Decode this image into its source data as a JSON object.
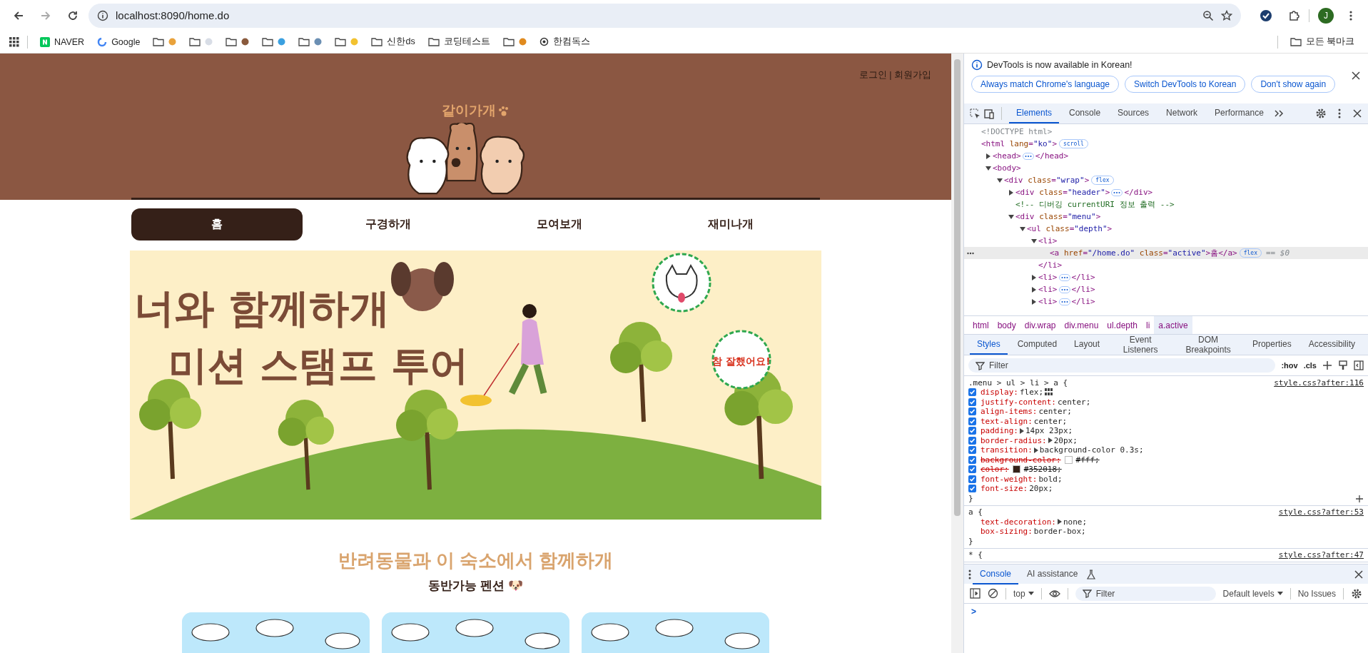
{
  "browser": {
    "url": "localhost:8090/home.do",
    "profile": "J",
    "bookmarks": [
      {
        "kind": "naver",
        "label": "NAVER"
      },
      {
        "kind": "google",
        "label": "Google"
      },
      {
        "kind": "folder",
        "color": "#e9a23b"
      },
      {
        "kind": "folder",
        "color": "#d8dde6"
      },
      {
        "kind": "folder",
        "color": "#8a5a3c"
      },
      {
        "kind": "folder",
        "color": "#3aa0e0"
      },
      {
        "kind": "folder",
        "color": "#6b8fb3"
      },
      {
        "kind": "folder",
        "color": "#f2c230"
      },
      {
        "kind": "folder",
        "label": "신한ds"
      },
      {
        "kind": "folder",
        "label": "코딩테스트"
      },
      {
        "kind": "folder",
        "color": "#e08a1e"
      },
      {
        "kind": "doc",
        "label": "한컴독스"
      }
    ],
    "all_bookmarks": "모든 북마크"
  },
  "page": {
    "auth": "로그인 | 회원가입",
    "logo": "같이가개",
    "menu": [
      {
        "label": "홈",
        "selected": true
      },
      {
        "label": "구경하개",
        "selected": false
      },
      {
        "label": "모여보개",
        "selected": false
      },
      {
        "label": "재미나개",
        "selected": false
      }
    ],
    "banner": {
      "title_line_1": "너와 함께하개",
      "title_line_2": "미션 스탬프 투어",
      "stamp": "참 잘했어요!"
    },
    "section_title": "반려동물과 이 숙소에서 함께하개",
    "section_subtitle": "동반가능 펜션 🐶"
  },
  "devtools": {
    "notice": {
      "message": "DevTools is now available in Korean!",
      "buttons": [
        "Always match Chrome's language",
        "Switch DevTools to Korean",
        "Don't show again"
      ]
    },
    "tabs": [
      {
        "label": "Elements",
        "selected": true
      },
      {
        "label": "Console",
        "selected": false
      },
      {
        "label": "Sources",
        "selected": false
      },
      {
        "label": "Network",
        "selected": false
      },
      {
        "label": "Performance",
        "selected": false
      }
    ],
    "dom": [
      {
        "kind": "doctype",
        "text": "<!DOCTYPE html>"
      },
      {
        "kind": "element",
        "text": "<html lang=\"ko\">",
        "badge": "scroll",
        "children": [
          {
            "kind": "element",
            "text": "<head>",
            "close": "</head>",
            "expanded": false
          },
          {
            "kind": "element",
            "text": "<body>",
            "expanded": true,
            "children": [
              {
                "kind": "element",
                "text": "<div class=\"wrap\">",
                "badge": "flex",
                "expanded": true,
                "children": [
                  {
                    "kind": "element",
                    "text": "<div class=\"header\">",
                    "close": "</div>",
                    "expanded": false
                  },
                  {
                    "kind": "comment",
                    "text": "<!-- 디버깅 currentURI 정보 출력 -->"
                  },
                  {
                    "kind": "element",
                    "text": "<div class=\"menu\">",
                    "expanded": true,
                    "children": [
                      {
                        "kind": "element",
                        "text": "<ul class=\"depth\">",
                        "expanded": true,
                        "children": [
                          {
                            "kind": "element",
                            "text": "<li>",
                            "close": "</li>",
                            "expanded": true,
                            "children": [
                              {
                                "kind": "element",
                                "text": "<a href=\"/home.do\" class=\"active\">홈</a>",
                                "badge": "flex",
                                "suffix": "== $0",
                                "selected": true
                              }
                            ]
                          },
                          {
                            "kind": "element",
                            "text": "<li>",
                            "close": "</li>",
                            "expanded": false
                          },
                          {
                            "kind": "element",
                            "text": "<li>",
                            "close": "</li>",
                            "expanded": false
                          },
                          {
                            "kind": "element",
                            "text": "<li>",
                            "close": "</li>",
                            "expanded": false
                          }
                        ]
                      }
                    ]
                  }
                ]
              }
            ]
          }
        ]
      }
    ],
    "breadcrumbs": [
      {
        "label": "html",
        "selected": false
      },
      {
        "label": "body",
        "selected": false
      },
      {
        "label": "div.wrap",
        "selected": false
      },
      {
        "label": "div.menu",
        "selected": false
      },
      {
        "label": "ul.depth",
        "selected": false
      },
      {
        "label": "li",
        "selected": false
      },
      {
        "label": "a.active",
        "selected": true
      }
    ],
    "style_tabs": [
      {
        "label": "Styles",
        "selected": true
      },
      {
        "label": "Computed",
        "selected": false
      },
      {
        "label": "Layout",
        "selected": false
      },
      {
        "label": "Event Listeners",
        "selected": false
      },
      {
        "label": "DOM Breakpoints",
        "selected": false
      },
      {
        "label": "Properties",
        "selected": false
      },
      {
        "label": "Accessibility",
        "selected": false
      }
    ],
    "filter": {
      "placeholder": "Filter",
      "hov": ":hov",
      "cls": ".cls"
    },
    "rules": [
      {
        "kind": "editable",
        "selector": ".menu > ul > li > a {",
        "source": "style.css?after:116",
        "close": "}",
        "declarations": [
          {
            "prop": "display:",
            "value": "flex;",
            "checked": true,
            "struck": false,
            "expandable": false,
            "editor": true
          },
          {
            "prop": "justify-content:",
            "value": "center;",
            "checked": true,
            "struck": false,
            "expandable": false,
            "editor": false
          },
          {
            "prop": "align-items:",
            "value": "center;",
            "checked": true,
            "struck": false,
            "expandable": false,
            "editor": false
          },
          {
            "prop": "text-align:",
            "value": "center;",
            "checked": true,
            "struck": false,
            "expandable": false,
            "editor": false
          },
          {
            "prop": "padding:",
            "value": "14px 23px;",
            "checked": true,
            "struck": false,
            "expandable": true,
            "editor": false
          },
          {
            "prop": "border-radius:",
            "value": "20px;",
            "checked": true,
            "struck": false,
            "expandable": true,
            "editor": false
          },
          {
            "prop": "transition:",
            "value": "background-color 0.3s;",
            "checked": true,
            "struck": false,
            "expandable": true,
            "editor": false
          },
          {
            "prop": "background-color:",
            "value": "#fff;",
            "color": "#ffffff",
            "checked": true,
            "struck": true,
            "expandable": false,
            "editor": false
          },
          {
            "prop": "color:",
            "value": "#352018;",
            "color": "#352018",
            "checked": true,
            "struck": true,
            "expandable": false,
            "editor": false
          },
          {
            "prop": "font-weight:",
            "value": "bold;",
            "checked": true,
            "struck": false,
            "expandable": false,
            "editor": false
          },
          {
            "prop": "font-size:",
            "value": "20px;",
            "checked": true,
            "struck": false,
            "expandable": false,
            "editor": false
          }
        ]
      },
      {
        "kind": "plain",
        "selector": "a {",
        "source": "style.css?after:53",
        "close": "}",
        "declarations": [
          {
            "prop": "text-decoration:",
            "value": "none;",
            "struck": false,
            "expandable": true,
            "editor": false
          },
          {
            "prop": "box-sizing:",
            "value": "border-box;",
            "struck": false,
            "expandable": false,
            "editor": false
          }
        ]
      },
      {
        "kind": "plain",
        "selector": "* {",
        "source": "style.css?after:47"
      }
    ],
    "drawer_tabs": [
      {
        "label": "Console",
        "selected": true
      },
      {
        "label": "AI assistance",
        "selected": false
      }
    ],
    "console": {
      "context": "top",
      "filter_placeholder": "Filter",
      "levels": "Default levels",
      "issues": "No Issues",
      "prompt": ">"
    }
  }
}
